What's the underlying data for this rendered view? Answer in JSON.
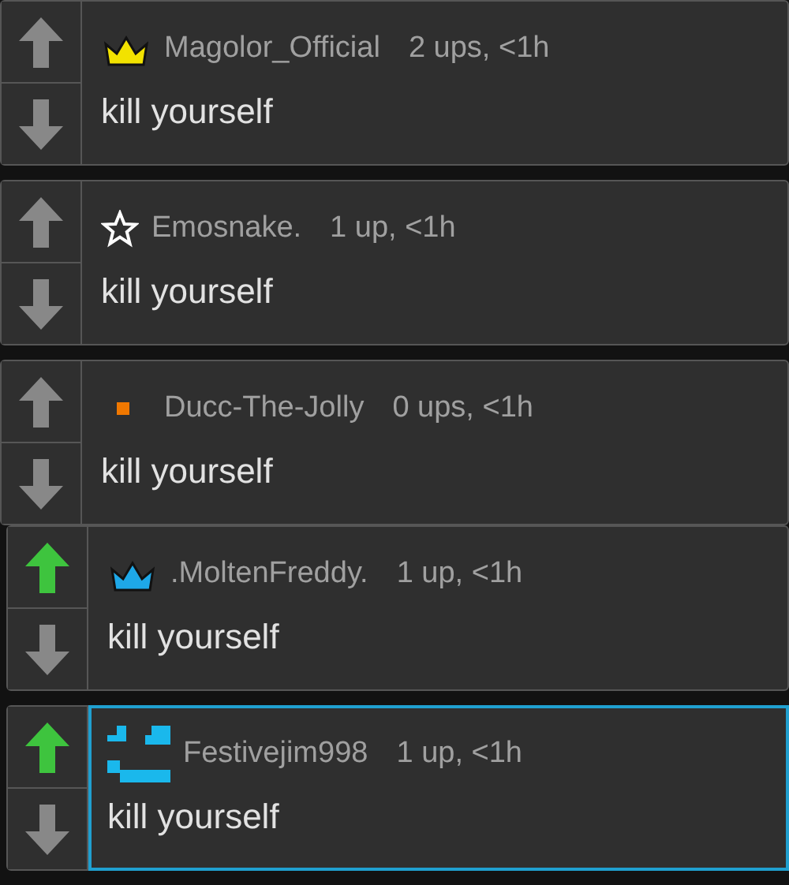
{
  "comments": [
    {
      "user": "Magolor_Official",
      "badge": {
        "kind": "crown",
        "color": "#f2e200"
      },
      "meta": "2 ups, <1h",
      "text": "kill yourself",
      "upvoted": false,
      "highlighted": false
    },
    {
      "user": "Emosnake.",
      "badge": {
        "kind": "star",
        "color": "#ffffff"
      },
      "meta": "1 up, <1h",
      "text": "kill yourself",
      "upvoted": false,
      "highlighted": false
    },
    {
      "user": "Ducc-The-Jolly",
      "badge": {
        "kind": "square",
        "color": "#f07800"
      },
      "meta": "0 ups, <1h",
      "text": "kill yourself",
      "upvoted": false,
      "highlighted": false,
      "children": [
        {
          "user": ".MoltenFreddy.",
          "badge": {
            "kind": "crown",
            "color": "#1ea8e8"
          },
          "meta": "1 up, <1h",
          "text": "kill yourself",
          "upvoted": true,
          "highlighted": false
        },
        {
          "user": "Festivejim998",
          "badge": {
            "kind": "face",
            "color": "#1ab8ec"
          },
          "meta": "1 up, <1h",
          "text": "kill yourself",
          "upvoted": true,
          "highlighted": true
        }
      ]
    }
  ]
}
